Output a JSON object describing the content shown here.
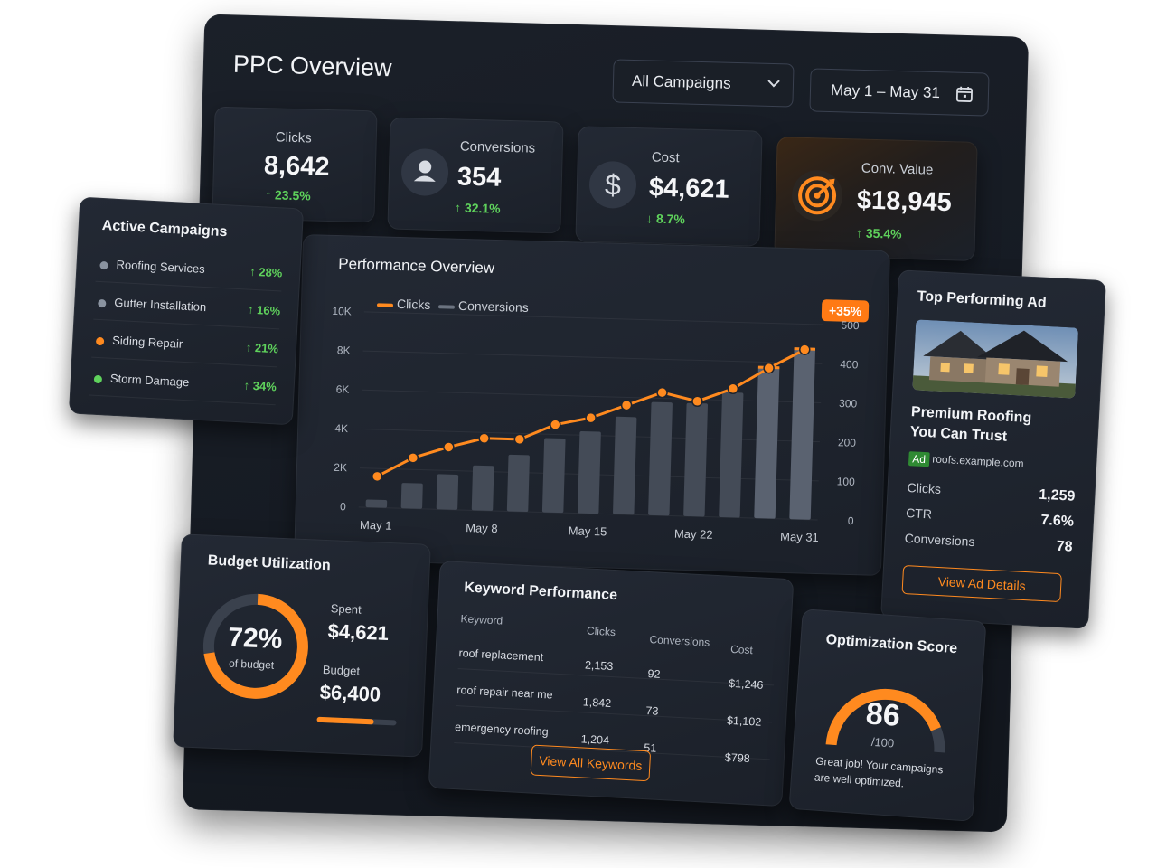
{
  "header": {
    "title": "PPC Overview",
    "campaign_filter": "All Campaigns",
    "date_range": "May 1 – May 31"
  },
  "kpis": [
    {
      "label": "Clicks",
      "value": "8,642",
      "delta": "↑ 23.5%"
    },
    {
      "label": "Conversions",
      "value": "354",
      "delta": "↑ 32.1%",
      "icon": "user-icon"
    },
    {
      "label": "Cost",
      "value": "$4,621",
      "delta": "↓ 8.7%",
      "icon": "dollar-icon"
    },
    {
      "label": "Conv. Value",
      "value": "$18,945",
      "delta": "↑ 35.4%",
      "icon": "target-icon"
    }
  ],
  "active_campaigns": {
    "title": "Active Campaigns",
    "items": [
      {
        "name": "Roofing Services",
        "change": "↑ 28%",
        "dot": "#8a93a0"
      },
      {
        "name": "Gutter Installation",
        "change": "↑ 16%",
        "dot": "#8a93a0"
      },
      {
        "name": "Siding Repair",
        "change": "↑ 21%",
        "dot": "#ff8a1f"
      },
      {
        "name": "Storm Damage",
        "change": "↑ 34%",
        "dot": "#5fd25c"
      }
    ]
  },
  "performance": {
    "title": "Performance Overview",
    "legend_clicks": "Clicks",
    "legend_conversions": "Conversions",
    "badge": "+35%",
    "left_ticks": [
      "10K",
      "8K",
      "6K",
      "4K",
      "2K",
      "0"
    ],
    "right_ticks": [
      "500",
      "400",
      "300",
      "200",
      "100",
      "0"
    ],
    "x_labels": [
      "May 1",
      "May 8",
      "May 15",
      "May 22",
      "May 31"
    ]
  },
  "chart_data": {
    "type": "line",
    "title": "Performance Overview",
    "series": [
      {
        "name": "Clicks",
        "axis": "left",
        "style": "line",
        "color": "#ff8a1f",
        "values": [
          1600,
          2600,
          3200,
          3700,
          3700,
          4500,
          4900,
          5600,
          6300,
          5900,
          6600,
          7700,
          8700
        ]
      },
      {
        "name": "Conversions",
        "axis": "right",
        "style": "bar",
        "color": "#4a5260",
        "values": [
          20,
          65,
          90,
          115,
          145,
          190,
          210,
          250,
          290,
          290,
          320,
          390,
          440
        ]
      }
    ],
    "ylim_left": [
      0,
      10000
    ],
    "ylim_right": [
      0,
      500
    ],
    "x_labels": [
      "May 1",
      "May 8",
      "May 15",
      "May 22",
      "May 31"
    ]
  },
  "top_ad": {
    "title": "Top Performing Ad",
    "headline_1": "Premium Roofing",
    "headline_2": "You Can Trust",
    "ad_badge": "Ad",
    "url": "roofs.example.com",
    "stats": [
      {
        "label": "Clicks",
        "value": "1,259"
      },
      {
        "label": "CTR",
        "value": "7.6%"
      },
      {
        "label": "Conversions",
        "value": "78"
      }
    ],
    "button": "View Ad Details"
  },
  "budget": {
    "title": "Budget Utilization",
    "percent": "72%",
    "percent_value": 0.72,
    "caption": "of budget",
    "spent_label": "Spent",
    "spent_value": "$4,621",
    "budget_label": "Budget",
    "budget_value": "$6,400"
  },
  "keywords": {
    "title": "Keyword Performance",
    "columns": [
      "Keyword",
      "Clicks",
      "Conversions",
      "Cost"
    ],
    "rows": [
      [
        "roof replacement",
        "2,153",
        "92",
        "$1,246"
      ],
      [
        "roof repair near me",
        "1,842",
        "73",
        "$1,102"
      ],
      [
        "emergency roofing",
        "1,204",
        "51",
        "$798"
      ]
    ],
    "button": "View All Keywords"
  },
  "optimization": {
    "title": "Optimization Score",
    "score": "86",
    "score_value": 86,
    "max": "/100",
    "message_1": "Great job! Your campaigns",
    "message_2": "are well optimized."
  }
}
